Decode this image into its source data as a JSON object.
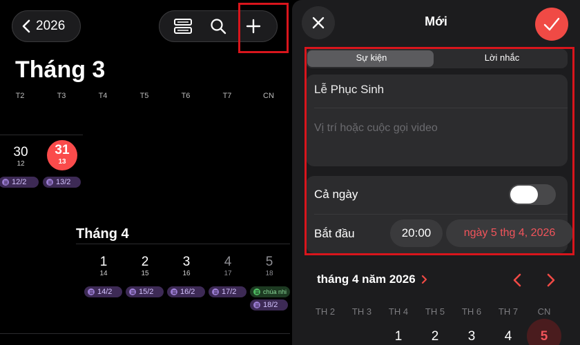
{
  "left": {
    "back": {
      "year": "2026"
    },
    "toolbar": {
      "list_icon": "list-icon",
      "search_icon": "search-icon",
      "add_icon": "plus-icon"
    },
    "march": {
      "title": "Tháng 3",
      "weekdays": [
        "T2",
        "T3",
        "T4",
        "T5",
        "T6",
        "T7",
        "CN"
      ],
      "days": [
        {
          "num": "30",
          "lunar": "12",
          "chip": "12/2"
        },
        {
          "num": "31",
          "lunar": "13",
          "chip": "13/2",
          "today": true
        }
      ]
    },
    "april": {
      "title": "Tháng 4",
      "days": [
        {
          "num": "1",
          "lunar": "14",
          "chip": "14/2"
        },
        {
          "num": "2",
          "lunar": "15",
          "chip": "15/2"
        },
        {
          "num": "3",
          "lunar": "16",
          "chip": "16/2"
        },
        {
          "num": "4",
          "lunar": "17",
          "chip": "17/2"
        },
        {
          "num": "5",
          "lunar": "18",
          "chip": "18/2",
          "extra_chip": "chúa nhi"
        }
      ]
    }
  },
  "right": {
    "title": "Mới",
    "segments": [
      "Sự kiện",
      "Lời nhắc"
    ],
    "event_title": "Lễ Phục Sinh",
    "location_placeholder": "Vị trí hoặc cuộc gọi video",
    "all_day_label": "Cả ngày",
    "all_day_on": false,
    "start_label": "Bắt đầu",
    "start_time": "20:00",
    "start_date": "ngày 5 thg 4, 2026",
    "calendar": {
      "month_label": "tháng 4 năm 2026",
      "weekdays": [
        "TH 2",
        "TH 3",
        "TH 4",
        "TH 5",
        "TH 6",
        "TH 7",
        "CN"
      ],
      "days": [
        "1",
        "2",
        "3",
        "4",
        "5"
      ],
      "selected": "5"
    }
  },
  "colors": {
    "accent_red": "#f04a45",
    "highlight_box": "#d9151c",
    "lunar_chip": "#3d2a55"
  }
}
